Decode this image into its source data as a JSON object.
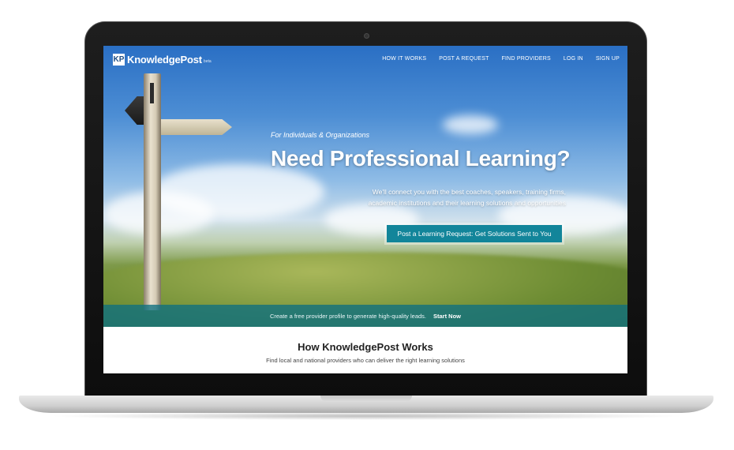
{
  "brand": {
    "name": "KnowledgePost",
    "badge": "beta",
    "logo_glyph": "KP"
  },
  "nav": {
    "items": [
      "HOW IT WORKS",
      "POST A REQUEST",
      "FIND PROVIDERS",
      "LOG IN",
      "SIGN UP"
    ]
  },
  "hero": {
    "kicker": "For Individuals & Organizations",
    "headline": "Need Professional Learning?",
    "subtext_line1": "We'll connect you with the best coaches, speakers, training firms,",
    "subtext_line2": "academic institutions and their learning solutions and opportunities",
    "cta_label": "Post a Learning Request: Get Solutions Sent to You"
  },
  "banner": {
    "text": "Create a free provider profile to generate high-quality leads.",
    "link": "Start Now"
  },
  "how": {
    "title": "How KnowledgePost Works",
    "subtitle": "Find local and national providers who can deliver the right learning solutions"
  },
  "colors": {
    "accent": "#12859a",
    "strip": "#0e7080"
  }
}
